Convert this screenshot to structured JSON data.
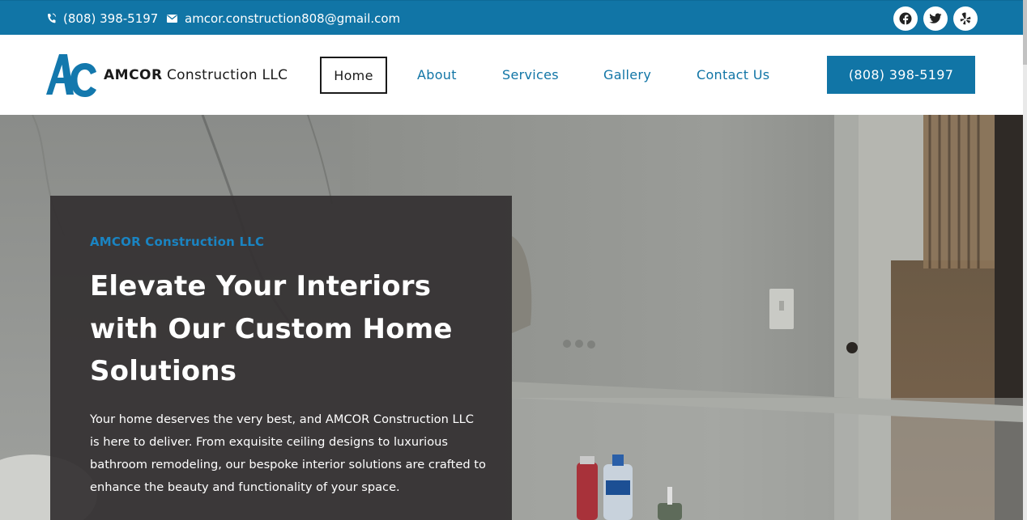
{
  "topbar": {
    "phone": "(808) 398-5197",
    "email": "amcor.construction808@gmail.com",
    "phone_icon": "phone-icon",
    "email_icon": "envelope-icon",
    "socials": [
      "facebook-icon",
      "twitter-icon",
      "yelp-icon"
    ],
    "bg_color": "#1175a6"
  },
  "header": {
    "logo_mark": "AC",
    "logo_name_bold": "AMCOR",
    "logo_name_light": "Construction LLC",
    "nav": {
      "home": "Home",
      "about": "About",
      "services": "Services",
      "gallery": "Gallery",
      "contact": "Contact Us"
    },
    "cta_label": "(808) 398-5197",
    "accent_color": "#1175a6"
  },
  "hero": {
    "eyebrow": "AMCOR Construction LLC",
    "title": "Elevate Your Interiors with Our Custom Home Solutions",
    "body": "Your home deserves the very best, and AMCOR Construction LLC is here to deliver. From exquisite ceiling designs to luxurious bathroom remodeling, our bespoke interior solutions are crafted to enhance the beauty and functionality of your space."
  }
}
